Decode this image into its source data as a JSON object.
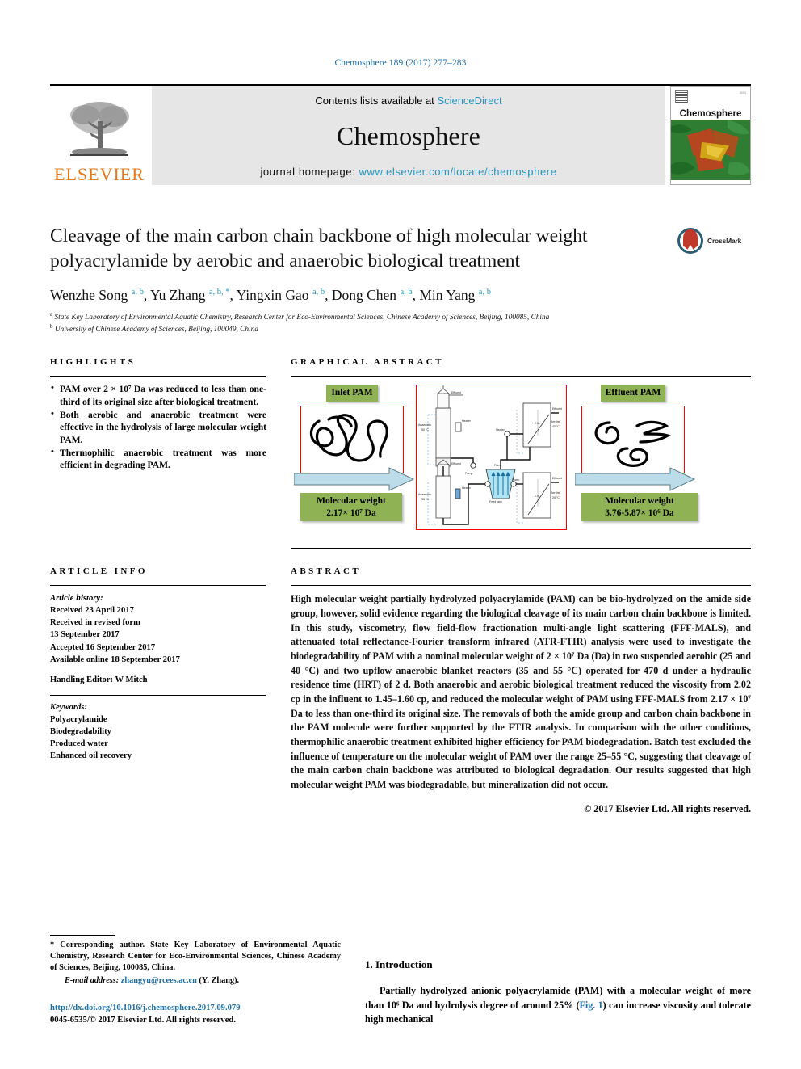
{
  "running_head": "Chemosphere 189 (2017) 277–283",
  "masthead": {
    "publisher": "ELSEVIER",
    "contents_prefix": "Contents lists available at ",
    "contents_link": "ScienceDirect",
    "journal_title": "Chemosphere",
    "homepage_prefix": "journal homepage: ",
    "homepage_url": "www.elsevier.com/locate/chemosphere",
    "cover_title": "Chemosphere"
  },
  "article": {
    "title": "Cleavage of the main carbon chain backbone of high molecular weight polyacrylamide by aerobic and anaerobic biological treatment",
    "crossmark_label": "CrossMark",
    "authors": [
      {
        "name": "Wenzhe Song",
        "marks": "a, b"
      },
      {
        "name": "Yu Zhang",
        "marks": "a, b, *"
      },
      {
        "name": "Yingxin Gao",
        "marks": "a, b"
      },
      {
        "name": "Dong Chen",
        "marks": "a, b"
      },
      {
        "name": "Min Yang",
        "marks": "a, b"
      }
    ],
    "affiliations": [
      {
        "mark": "a",
        "text": "State Key Laboratory of Environmental Aquatic Chemistry, Research Center for Eco-Environmental Sciences, Chinese Academy of Sciences, Beijing, 100085, China"
      },
      {
        "mark": "b",
        "text": "University of Chinese Academy of Sciences, Beijing, 100049, China"
      }
    ]
  },
  "highlights": {
    "label": "HIGHLIGHTS",
    "items": [
      "PAM over 2 × 10⁷ Da was reduced to less than one-third of its original size after biological treatment.",
      "Both aerobic and anaerobic treatment were effective in the hydrolysis of large molecular weight PAM.",
      "Thermophilic anaerobic treatment was more efficient in degrading PAM."
    ]
  },
  "graphical_abstract": {
    "label": "GRAPHICAL ABSTRACT",
    "inlet_label": "Inlet PAM",
    "inlet_mw_line1": "Molecular weight",
    "inlet_mw_line2": "2.17× 10⁷ Da",
    "effluent_label": "Effluent PAM",
    "effluent_mw_line1": "Molecular weight",
    "effluent_mw_line2": "3.76-5.87× 10⁶ Da",
    "diagram_labels": {
      "anaerobic_thermo": "Anaerobic 55 °C",
      "anaerobic_meso": "Anaerobic 35 °C",
      "aerobic_40": "Aerobic 40 °C",
      "aerobic_25": "Aerobic 25 °C",
      "effluent": "Effluent",
      "pump": "Pump",
      "heater": "Heater",
      "feedtank": "Feed tank",
      "volume": "2.5L"
    }
  },
  "article_info": {
    "label": "ARTICLE INFO",
    "history_head": "Article history:",
    "history": [
      "Received 23 April 2017",
      "Received in revised form",
      "13 September 2017",
      "Accepted 16 September 2017",
      "Available online 18 September 2017"
    ],
    "handling_editor": "Handling Editor: W Mitch",
    "keywords_head": "Keywords:",
    "keywords": [
      "Polyacrylamide",
      "Biodegradability",
      "Produced water",
      "Enhanced oil recovery"
    ]
  },
  "abstract": {
    "label": "ABSTRACT",
    "text": "High molecular weight partially hydrolyzed polyacrylamide (PAM) can be bio-hydrolyzed on the amide side group, however, solid evidence regarding the biological cleavage of its main carbon chain backbone is limited. In this study, viscometry, flow field-flow fractionation multi-angle light scattering (FFF-MALS), and attenuated total reflectance-Fourier transform infrared (ATR-FTIR) analysis were used to investigate the biodegradability of PAM with a nominal molecular weight of 2 × 10⁷ Da (Da) in two suspended aerobic (25 and 40 °C) and two upflow anaerobic blanket reactors (35 and 55 °C) operated for 470 d under a hydraulic residence time (HRT) of 2 d. Both anaerobic and aerobic biological treatment reduced the viscosity from 2.02 cp in the influent to 1.45–1.60 cp, and reduced the molecular weight of PAM using FFF-MALS from 2.17 × 10⁷ Da to less than one-third its original size. The removals of both the amide group and carbon chain backbone in the PAM molecule were further supported by the FTIR analysis. In comparison with the other conditions, thermophilic anaerobic treatment exhibited higher efficiency for PAM biodegradation. Batch test excluded the influence of temperature on the molecular weight of PAM over the range 25–55 °C, suggesting that cleavage of the main carbon chain backbone was attributed to biological degradation. Our results suggested that high molecular weight PAM was biodegradable, but mineralization did not occur.",
    "copyright": "© 2017 Elsevier Ltd. All rights reserved."
  },
  "footer": {
    "corresponding_note": "* Corresponding author. State Key Laboratory of Environmental Aquatic Chemistry, Research Center for Eco-Environmental Sciences, Chinese Academy of Sciences, Beijing, 100085, China.",
    "email_label": "E-mail address:",
    "email": "zhangyu@rcees.ac.cn",
    "email_owner": "(Y. Zhang).",
    "doi": "http://dx.doi.org/10.1016/j.chemosphere.2017.09.079",
    "issn_line": "0045-6535/© 2017 Elsevier Ltd. All rights reserved."
  },
  "introduction": {
    "heading": "1. Introduction",
    "paragraph_part1": "Partially hydrolyzed anionic polyacrylamide (PAM) with a molecular weight of more than 10⁶ Da and hydrolysis degree of around 25% (",
    "fig_link": "Fig. 1",
    "paragraph_part2": ") can increase viscosity and tolerate high mechanical"
  },
  "colors": {
    "link_blue": "#1c6ea4",
    "sciencedirect_blue": "#2596be",
    "elsevier_orange": "#E77817",
    "green_label": "#8FB354",
    "red_box": "#ff0000",
    "arrow_blue": "#BBDCE8"
  }
}
